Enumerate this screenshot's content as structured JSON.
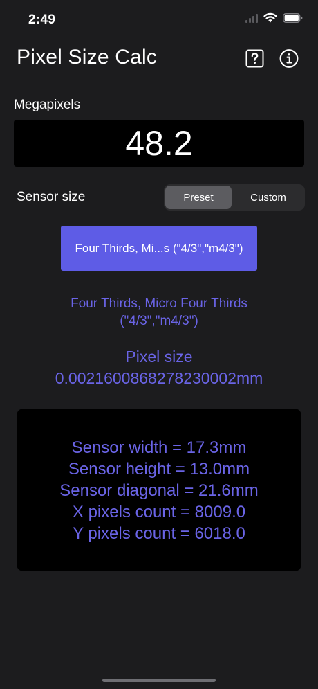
{
  "status_bar": {
    "time": "2:49"
  },
  "header": {
    "title": "Pixel Size Calc",
    "help_icon": "question-mark-square-icon",
    "info_icon": "info-circle-icon"
  },
  "megapixels": {
    "label": "Megapixels",
    "value": "48.2"
  },
  "sensor": {
    "label": "Sensor size",
    "segments": [
      "Preset",
      "Custom"
    ],
    "selected_segment": "Preset",
    "preset_button_label": "Four Thirds, Mi...s (\"4/3\",\"m4/3\")",
    "description_line1": "Four Thirds, Micro Four Thirds",
    "description_line2": "(\"4/3\",\"m4/3\")"
  },
  "pixel_size": {
    "title": "Pixel size",
    "value": "0.0021600868278230002mm"
  },
  "results": {
    "width": "Sensor width = 17.3mm",
    "height": "Sensor height = 13.0mm",
    "diagonal": "Sensor diagonal = 21.6mm",
    "x_pixels": "X pixels count = 8009.0",
    "y_pixels": "Y pixels count = 6018.0"
  },
  "colors": {
    "background": "#1c1c1e",
    "accent": "#5e5ce6",
    "accent_text": "#6a64e6",
    "panel": "#000000"
  }
}
